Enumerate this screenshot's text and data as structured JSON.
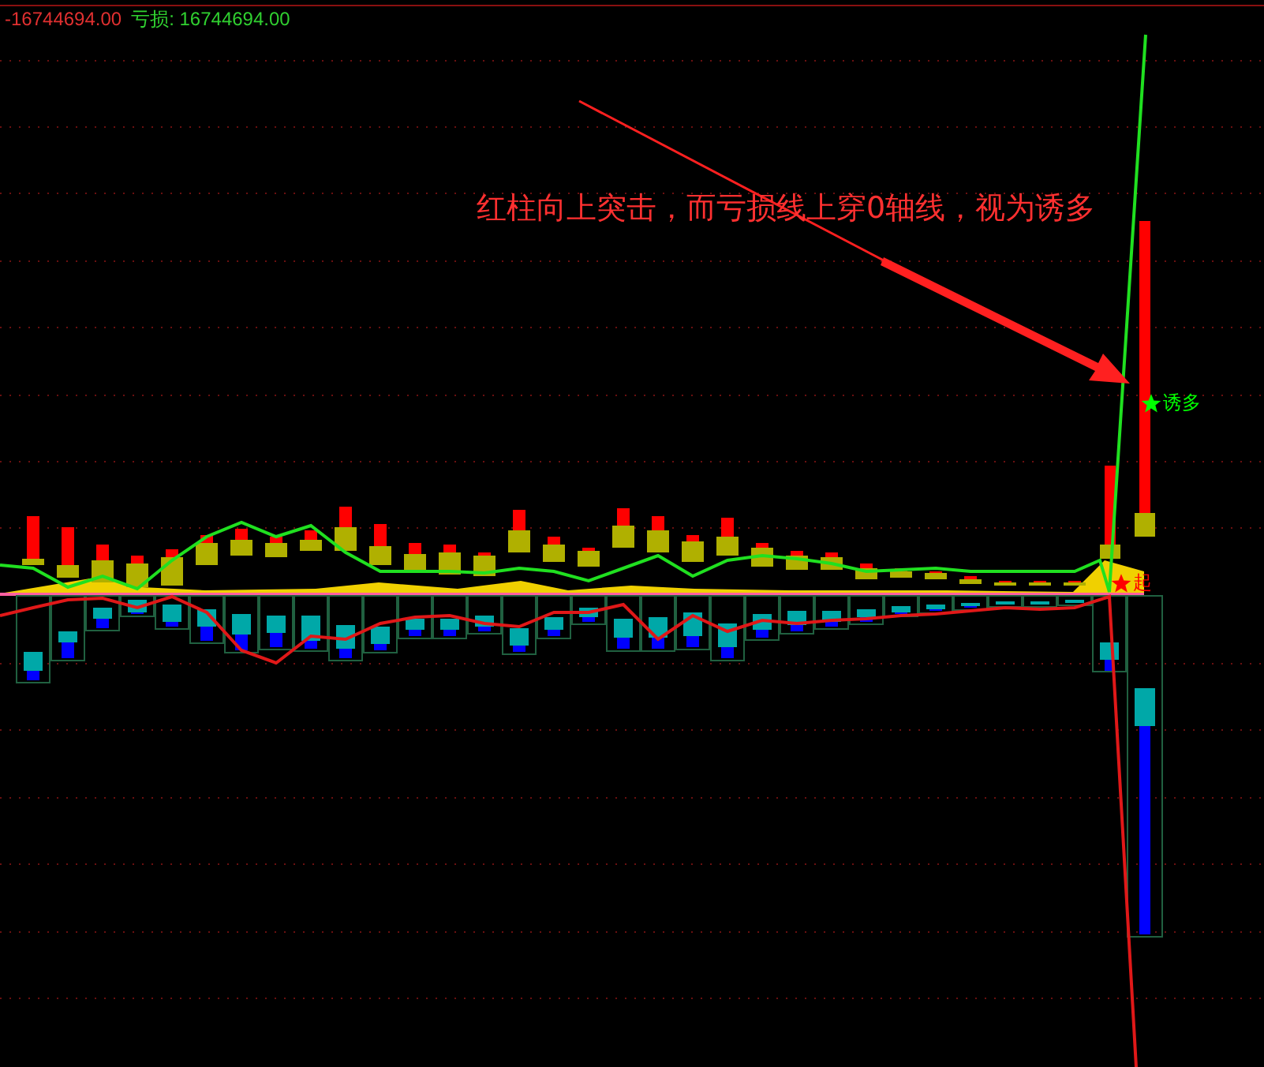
{
  "header": {
    "value": "-16744694.00",
    "loss": "亏损: 16744694.00"
  },
  "annotation": "红柱向上突击，而亏损线上穿0轴线，视为诱多",
  "signals": [
    {
      "kind": "trap",
      "label": "诱多",
      "color": "#00ff00"
    },
    {
      "kind": "start",
      "label": "起",
      "color": "#ff0000"
    }
  ]
}
